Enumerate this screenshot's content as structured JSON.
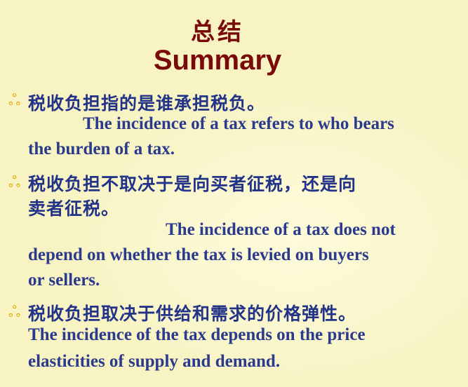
{
  "title": {
    "cn": "总结",
    "en": "Summary"
  },
  "points": [
    {
      "icon": "decorative-bullet-icon",
      "cn_line1": "税收负担指的是谁承担税负。",
      "en_line1": "The incidence of a tax refers to who bears",
      "en_line2": "the burden of a tax."
    },
    {
      "icon": "decorative-bullet-icon",
      "cn_line1": "税收负担不取决于是向买者征税，还是向",
      "cn_line2": "卖者征税。",
      "en_line1": "The incidence of a tax does not",
      "en_line2": "depend on whether the tax is levied on buyers",
      "en_line3": "or sellers."
    },
    {
      "icon": "decorative-bullet-icon",
      "cn_line1": "税收负担取决于供给和需求的价格弹性。",
      "en_line1": "The incidence of the tax depends on the price",
      "en_line2": "elasticities of supply and demand."
    }
  ],
  "colors": {
    "title": "#7a0a0a",
    "text": "#223388",
    "bullet": "#e2a900",
    "background": "#fbf8d2"
  }
}
